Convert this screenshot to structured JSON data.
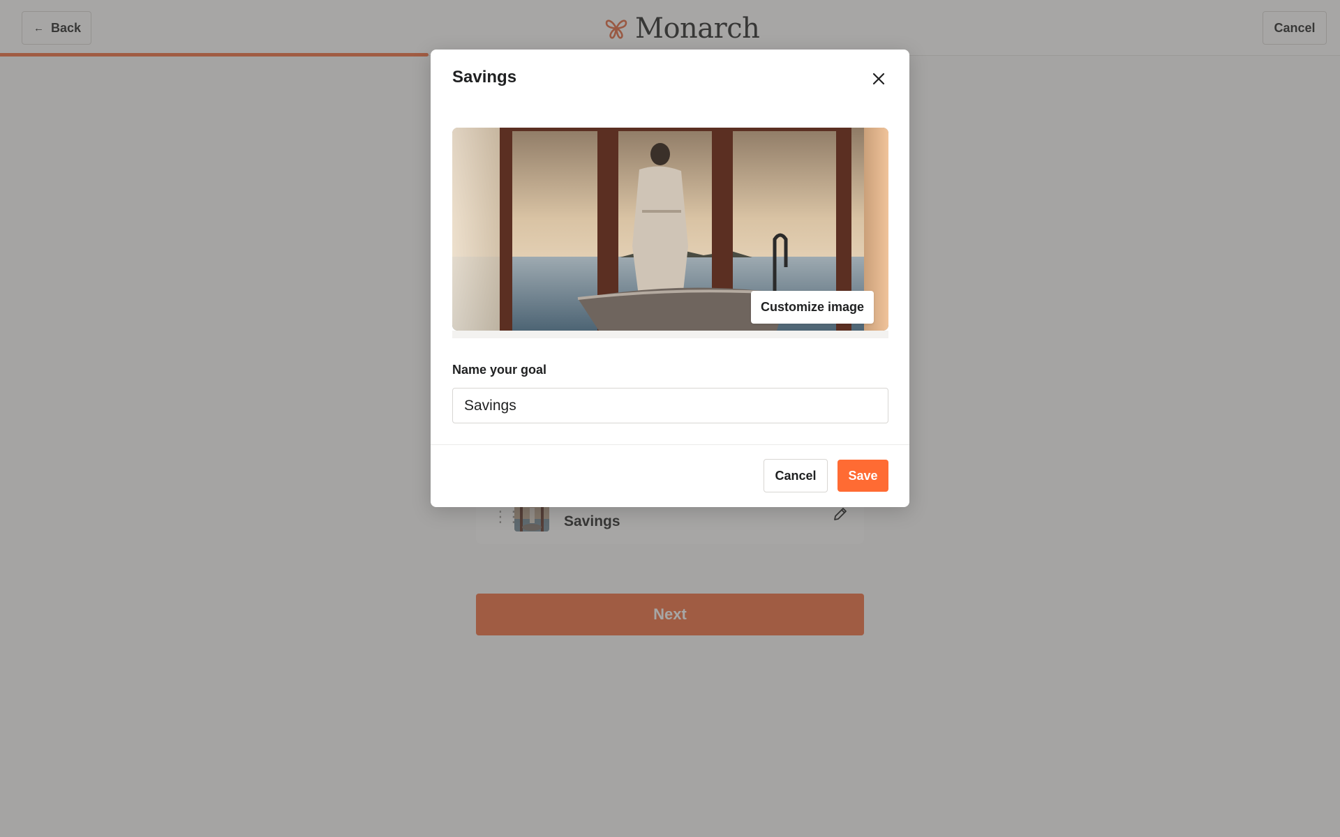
{
  "header": {
    "back_label": "Back",
    "brand_name": "Monarch",
    "cancel_label": "Cancel",
    "progress_fraction": 0.32
  },
  "goal_list": {
    "items": [
      {
        "label": "Savings"
      }
    ]
  },
  "next_label": "Next",
  "modal": {
    "title": "Savings",
    "customize_image_label": "Customize image",
    "field_label": "Name your goal",
    "goal_name_value": "Savings",
    "cancel_label": "Cancel",
    "save_label": "Save"
  },
  "colors": {
    "accent": "#ff6b33",
    "progress": "#f06a3a",
    "overlay": "rgba(80,78,76,0.5)"
  },
  "icons": {
    "back": "arrow-left-icon",
    "brand": "butterfly-icon",
    "close": "close-icon",
    "edit": "pencil-icon",
    "drag": "drag-handle-icon"
  }
}
